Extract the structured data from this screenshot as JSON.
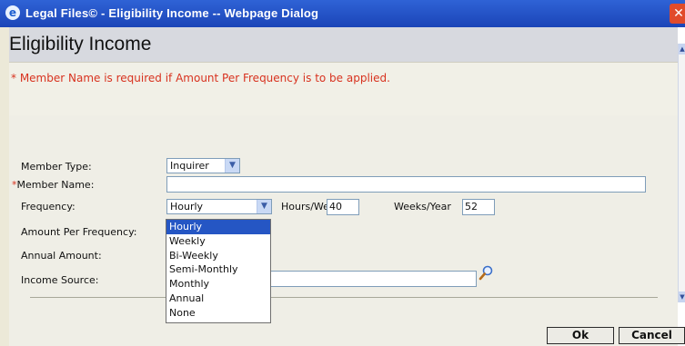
{
  "window": {
    "title": "Legal Files© - Eligibility Income -- Webpage Dialog",
    "close_glyph": "✕"
  },
  "page": {
    "heading": "Eligibility Income",
    "note_marker": "*",
    "note_text": " Member Name is required if Amount Per Frequency is to be applied."
  },
  "form": {
    "member_type_label": "Member Type:",
    "member_type_value": "Inquirer",
    "member_name_required_marker": "*",
    "member_name_label": "Member Name:",
    "member_name_value": "",
    "frequency_label": "Frequency:",
    "frequency_value": "Hourly",
    "hours_week_label": "Hours/Week",
    "hours_week_value": "40",
    "weeks_year_label": "Weeks/Year",
    "weeks_year_value": "52",
    "amount_per_frequency_label": "Amount Per Frequency:",
    "annual_amount_label": "Annual Amount:",
    "income_source_label": "Income Source:",
    "income_source_value": ""
  },
  "frequency_options": [
    "Hourly",
    "Weekly",
    "Bi-Weekly",
    "Semi-Monthly",
    "Monthly",
    "Annual",
    "None"
  ],
  "buttons": {
    "ok": "Ok",
    "cancel": "Cancel"
  },
  "icons": {
    "app": "ie-icon",
    "search": "magnifier-icon",
    "dropdown": "chevron-down-icon"
  },
  "colors": {
    "title_bar": "#2456c8",
    "required": "#d8321f",
    "selection": "#2556c4"
  }
}
